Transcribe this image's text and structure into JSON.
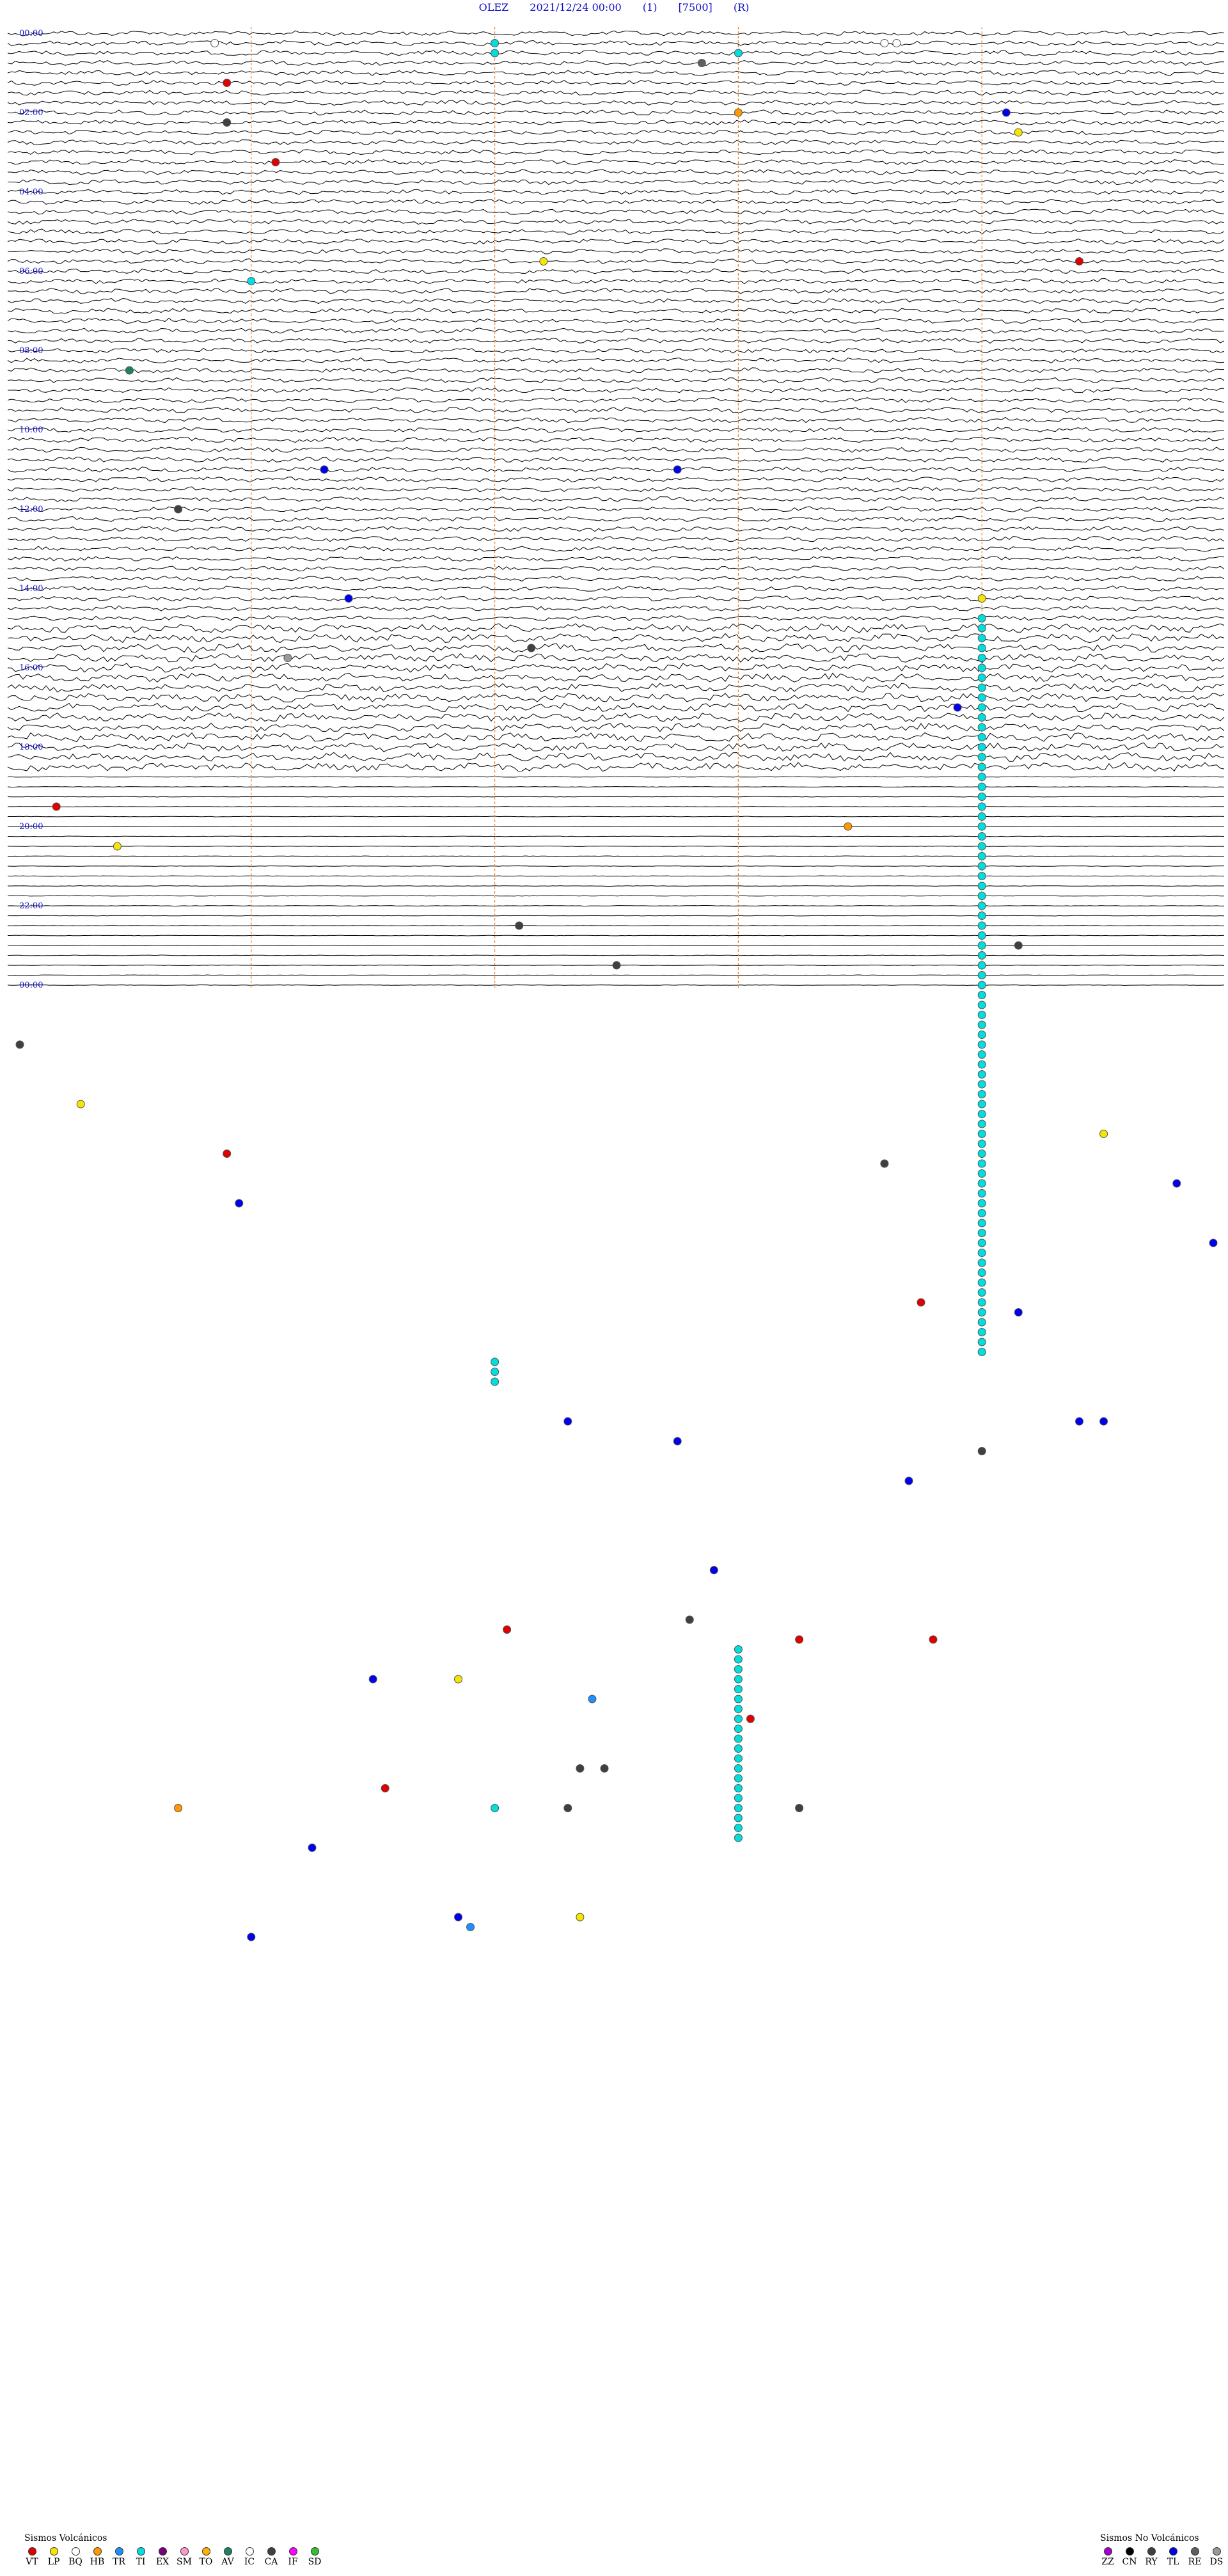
{
  "header": {
    "station": "OLEZ",
    "datetime": "2021/12/24 00:00",
    "channel": "(1)",
    "scale": "[7500]",
    "mode": "(R)"
  },
  "chart_data": {
    "type": "helicorder",
    "time_labels": [
      "00:00",
      "02:00",
      "04:00",
      "06:00",
      "08:00",
      "10:00",
      "12:00",
      "14:00",
      "16:00",
      "18:00",
      "20:00",
      "22:00",
      "00:00"
    ],
    "rows_per_label": 8,
    "event_colors": {
      "VT": "#e00000",
      "LP": "#f5e600",
      "BQ": "#ffffff",
      "HB": "#ff9900",
      "TR": "#1e90ff",
      "TI": "#00dede",
      "EX": "#7a007a",
      "SM": "#ff99cc",
      "TO": "#ffb000",
      "AV": "#208060",
      "IC": "#ffffff",
      "CA": "#404040",
      "IF": "#ff00ff",
      "SD": "#30c030",
      "ZZ": "#a000c8",
      "CN": "#000000",
      "RY": "#404040",
      "TL": "#0000ee",
      "RE": "#606060",
      "DS": "#999999"
    },
    "events": [
      {
        "row": 1,
        "t": 0.17,
        "type": "BQ"
      },
      {
        "row": 1,
        "t": 0.4,
        "type": "TI"
      },
      {
        "row": 1,
        "t": 0.72,
        "type": "BQ"
      },
      {
        "row": 1,
        "t": 0.73,
        "type": "BQ"
      },
      {
        "row": 2,
        "t": 0.4,
        "type": "TI"
      },
      {
        "row": 2,
        "t": 0.6,
        "type": "TI"
      },
      {
        "row": 3,
        "t": 0.57,
        "type": "RE"
      },
      {
        "row": 5,
        "t": 0.18,
        "type": "VT"
      },
      {
        "row": 8,
        "t": 0.6,
        "type": "HB"
      },
      {
        "row": 8,
        "t": 0.82,
        "type": "TL"
      },
      {
        "row": 9,
        "t": 0.18,
        "type": "CA"
      },
      {
        "row": 10,
        "t": 0.83,
        "type": "LP"
      },
      {
        "row": 13,
        "t": 0.22,
        "type": "VT"
      },
      {
        "row": 23,
        "t": 0.44,
        "type": "LP"
      },
      {
        "row": 23,
        "t": 0.88,
        "type": "VT"
      },
      {
        "row": 25,
        "t": 0.2,
        "type": "TI"
      },
      {
        "row": 34,
        "t": 0.1,
        "type": "AV"
      },
      {
        "row": 44,
        "t": 0.26,
        "type": "TL"
      },
      {
        "row": 44,
        "t": 0.55,
        "type": "TL"
      },
      {
        "row": 48,
        "t": 0.14,
        "type": "CA"
      },
      {
        "row": 57,
        "t": 0.28,
        "type": "TL"
      },
      {
        "row": 57,
        "t": 0.8,
        "type": "LP"
      },
      {
        "row": 62,
        "t": 0.43,
        "type": "CA"
      },
      {
        "row": 63,
        "t": 0.23,
        "type": "DS"
      },
      {
        "row": 68,
        "t": 0.78,
        "type": "TL"
      },
      {
        "row": 78,
        "t": 0.04,
        "type": "VT"
      },
      {
        "row": 80,
        "t": 0.69,
        "type": "HB"
      },
      {
        "row": 82,
        "t": 0.09,
        "type": "LP"
      },
      {
        "row": 90,
        "t": 0.42,
        "type": "CA"
      },
      {
        "row": 92,
        "t": 0.83,
        "type": "CA"
      },
      {
        "row": 94,
        "t": 0.5,
        "type": "CA"
      },
      {
        "row": 102,
        "t": 0.01,
        "type": "CA"
      },
      {
        "row": 108,
        "t": 0.06,
        "type": "LP"
      },
      {
        "row": 111,
        "t": 0.9,
        "type": "LP"
      },
      {
        "row": 113,
        "t": 0.18,
        "type": "VT"
      },
      {
        "row": 114,
        "t": 0.72,
        "type": "CA"
      },
      {
        "row": 116,
        "t": 0.96,
        "type": "TL"
      },
      {
        "row": 118,
        "t": 0.19,
        "type": "TL"
      },
      {
        "row": 122,
        "t": 0.99,
        "type": "TL"
      },
      {
        "row": 128,
        "t": 0.75,
        "type": "VT"
      },
      {
        "row": 129,
        "t": 0.83,
        "type": "TL"
      },
      {
        "row": 140,
        "t": 0.46,
        "type": "TL"
      },
      {
        "row": 140,
        "t": 0.88,
        "type": "TL"
      },
      {
        "row": 140,
        "t": 0.9,
        "type": "TL"
      },
      {
        "row": 142,
        "t": 0.55,
        "type": "TL"
      },
      {
        "row": 143,
        "t": 0.8,
        "type": "CA"
      },
      {
        "row": 146,
        "t": 0.74,
        "type": "TL"
      },
      {
        "row": 155,
        "t": 0.58,
        "type": "TL"
      },
      {
        "row": 160,
        "t": 0.56,
        "type": "CA"
      },
      {
        "row": 161,
        "t": 0.41,
        "type": "VT"
      },
      {
        "row": 162,
        "t": 0.65,
        "type": "VT"
      },
      {
        "row": 162,
        "t": 0.76,
        "type": "VT"
      },
      {
        "row": 166,
        "t": 0.3,
        "type": "TL"
      },
      {
        "row": 166,
        "t": 0.37,
        "type": "LP"
      },
      {
        "row": 168,
        "t": 0.48,
        "type": "TR"
      },
      {
        "row": 170,
        "t": 0.61,
        "type": "VT"
      },
      {
        "row": 175,
        "t": 0.47,
        "type": "CA"
      },
      {
        "row": 175,
        "t": 0.49,
        "type": "CA"
      },
      {
        "row": 177,
        "t": 0.31,
        "type": "VT"
      },
      {
        "row": 179,
        "t": 0.14,
        "type": "HB"
      },
      {
        "row": 179,
        "t": 0.4,
        "type": "TI"
      },
      {
        "row": 179,
        "t": 0.46,
        "type": "CA"
      },
      {
        "row": 179,
        "t": 0.65,
        "type": "CA"
      },
      {
        "row": 183,
        "t": 0.25,
        "type": "TL"
      },
      {
        "row": 190,
        "t": 0.37,
        "type": "TL"
      },
      {
        "row": 190,
        "t": 0.47,
        "type": "LP"
      },
      {
        "row": 191,
        "t": 0.38,
        "type": "TR"
      },
      {
        "row": 192,
        "t": 0.2,
        "type": "TL"
      }
    ],
    "ti_runs": [
      {
        "t": 0.8,
        "row_start": 59,
        "row_end": 133
      },
      {
        "t": 0.4,
        "row_start": 134,
        "row_end": 136
      },
      {
        "t": 0.6,
        "row_start": 163,
        "row_end": 182
      }
    ]
  },
  "legend_volcanic": {
    "title": "Sismos Volcánicos",
    "items": [
      {
        "code": "VT",
        "color": "#e00000"
      },
      {
        "code": "LP",
        "color": "#f5e600"
      },
      {
        "code": "BQ",
        "color": "#ffffff"
      },
      {
        "code": "HB",
        "color": "#ff9900"
      },
      {
        "code": "TR",
        "color": "#1e90ff"
      },
      {
        "code": "TI",
        "color": "#00dede"
      },
      {
        "code": "EX",
        "color": "#7a007a"
      },
      {
        "code": "SM",
        "color": "#ff99cc"
      },
      {
        "code": "TO",
        "color": "#ffb000"
      },
      {
        "code": "AV",
        "color": "#208060"
      },
      {
        "code": "IC",
        "color": "#ffffff"
      },
      {
        "code": "CA",
        "color": "#404040"
      },
      {
        "code": "IF",
        "color": "#ff00ff"
      },
      {
        "code": "SD",
        "color": "#30c030"
      }
    ]
  },
  "legend_nonvolcanic": {
    "title": "Sismos No Volcánicos",
    "items": [
      {
        "code": "ZZ",
        "color": "#a000c8"
      },
      {
        "code": "CN",
        "color": "#000000"
      },
      {
        "code": "RY",
        "color": "#404040"
      },
      {
        "code": "TL",
        "color": "#0000ee"
      },
      {
        "code": "RE",
        "color": "#606060"
      },
      {
        "code": "DS",
        "color": "#999999"
      }
    ]
  }
}
